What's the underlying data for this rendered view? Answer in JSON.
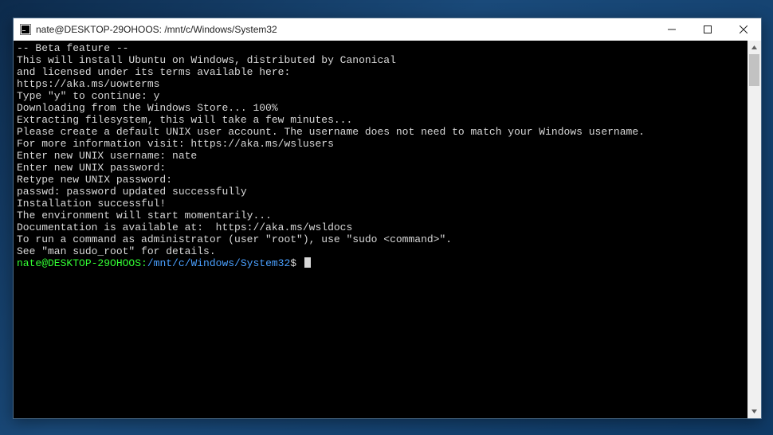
{
  "window": {
    "title": "nate@DESKTOP-29OHOOS: /mnt/c/Windows/System32"
  },
  "terminal": {
    "lines": [
      "-- Beta feature --",
      "This will install Ubuntu on Windows, distributed by Canonical",
      "and licensed under its terms available here:",
      "https://aka.ms/uowterms",
      "",
      "Type \"y\" to continue: y",
      "Downloading from the Windows Store... 100%",
      "Extracting filesystem, this will take a few minutes...",
      "Please create a default UNIX user account. The username does not need to match your Windows username.",
      "For more information visit: https://aka.ms/wslusers",
      "Enter new UNIX username: nate",
      "Enter new UNIX password:",
      "Retype new UNIX password:",
      "passwd: password updated successfully",
      "Installation successful!",
      "The environment will start momentarily...",
      "Documentation is available at:  https://aka.ms/wsldocs",
      "To run a command as administrator (user \"root\"), use \"sudo <command>\".",
      "See \"man sudo_root\" for details.",
      ""
    ],
    "prompt": {
      "user_host": "nate@DESKTOP-29OHOOS",
      "sep": ":",
      "path": "/mnt/c/Windows/System32",
      "symbol": "$"
    }
  }
}
